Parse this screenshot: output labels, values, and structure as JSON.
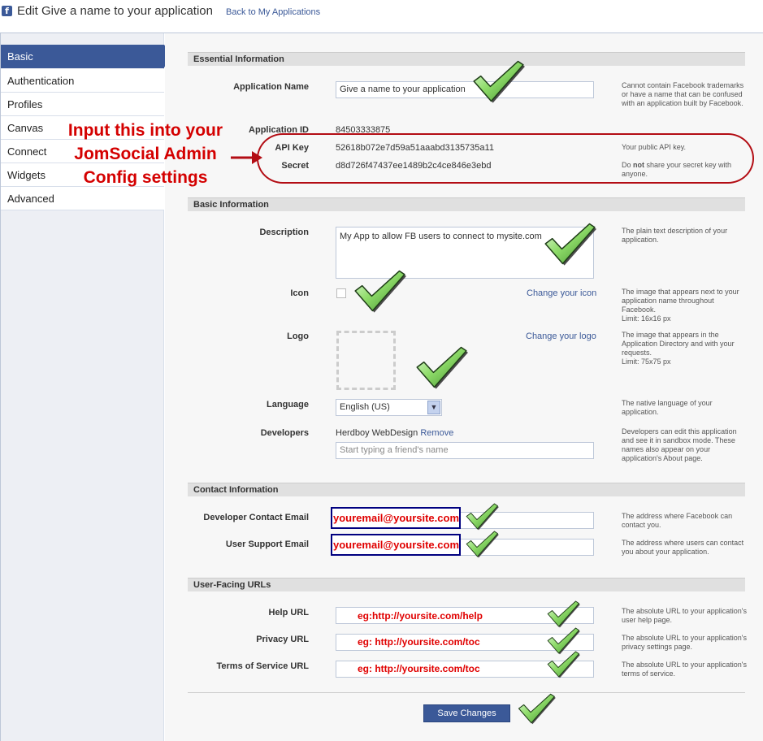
{
  "header": {
    "logo_letter": "f",
    "title": "Edit Give a name to your application",
    "back_link": "Back to My Applications"
  },
  "sidebar": {
    "items": [
      {
        "label": "Basic",
        "active": true
      },
      {
        "label": "Authentication"
      },
      {
        "label": "Profiles"
      },
      {
        "label": "Canvas"
      },
      {
        "label": "Connect"
      },
      {
        "label": "Widgets"
      },
      {
        "label": "Advanced"
      }
    ]
  },
  "essential": {
    "header": "Essential Information",
    "app_name_label": "Application Name",
    "app_name_value": "Give a name to your application",
    "app_name_help": "Cannot contain Facebook trademarks or have a name that can be confused with an application built by Facebook.",
    "app_id_label": "Application ID",
    "app_id_value": "84503333875",
    "api_key_label": "API Key",
    "api_key_value": "52618b072e7d59a51aaabd3135735a11",
    "api_key_help": "Your public API key.",
    "secret_label": "Secret",
    "secret_value": "d8d726f47437ee1489b2c4ce846e3ebd",
    "secret_help_pre": "Do ",
    "secret_help_bold": "not",
    "secret_help_post": " share your secret key with anyone."
  },
  "annotation": {
    "line1": "Input this into your",
    "line2": "JomSocial Admin",
    "line3": "Config settings",
    "color": "#d40000"
  },
  "basic": {
    "header": "Basic Information",
    "description_label": "Description",
    "description_value": "My App to allow FB users to connect to mysite.com",
    "description_help": "The plain text description of your application.",
    "icon_label": "Icon",
    "icon_link": "Change your icon",
    "icon_help": "The image that appears next to your application name throughout Facebook.",
    "icon_limit": "Limit: 16x16 px",
    "logo_label": "Logo",
    "logo_link": "Change your logo",
    "logo_help": "The image that appears in the Application Directory and with your requests.",
    "logo_limit": "Limit: 75x75 px",
    "language_label": "Language",
    "language_value": "English (US)",
    "language_help": "The native language of your application.",
    "developers_label": "Developers",
    "developer_name": "Herdboy WebDesign",
    "developer_remove": "Remove",
    "developers_placeholder": "Start typing a friend's name",
    "developers_help": "Developers can edit this application and see it in sandbox mode. These names also appear on your application's About page."
  },
  "contact": {
    "header": "Contact Information",
    "dev_email_label": "Developer Contact Email",
    "dev_email_value": "youremail@yoursite.com",
    "dev_email_help": "The address where Facebook can contact you.",
    "support_email_label": "User Support Email",
    "support_email_value": "youremail@yoursite.com",
    "support_email_help": "The address where users can contact you about your application."
  },
  "urls": {
    "header": "User-Facing URLs",
    "help_label": "Help URL",
    "help_value": "eg:http://yoursite.com/help",
    "help_help": "The absolute URL to your application's user help page.",
    "privacy_label": "Privacy URL",
    "privacy_value": "eg: http://yoursite.com/toc",
    "privacy_help": "The absolute URL to your application's privacy settings page.",
    "tos_label": "Terms of Service URL",
    "tos_value": "eg: http://yoursite.com/toc",
    "tos_help": "The absolute URL to your application's terms of service."
  },
  "save_label": "Save Changes",
  "colors": {
    "facebook_blue": "#3b5998",
    "annotation_red": "#d40000",
    "check_green": "#7fcf5a"
  }
}
